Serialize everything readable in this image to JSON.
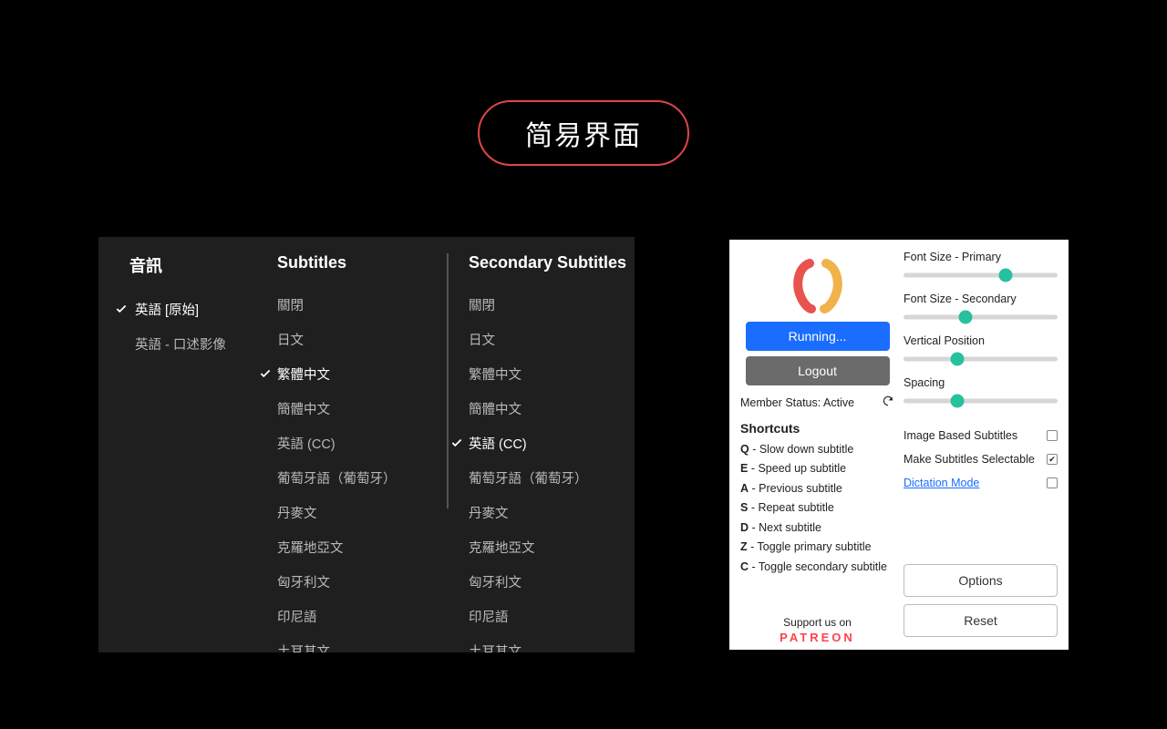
{
  "title": "简易界面",
  "audio": {
    "header": "音訊",
    "items": [
      {
        "label": "英語 [原始]",
        "selected": true
      },
      {
        "label": "英語 - 口述影像",
        "selected": false
      }
    ]
  },
  "subtitles": {
    "header": "Subtitles",
    "items": [
      {
        "label": "關閉",
        "selected": false
      },
      {
        "label": "日文",
        "selected": false
      },
      {
        "label": "繁體中文",
        "selected": true
      },
      {
        "label": "簡體中文",
        "selected": false
      },
      {
        "label": "英語 (CC)",
        "selected": false
      },
      {
        "label": "葡萄牙語（葡萄牙）",
        "selected": false
      },
      {
        "label": "丹麥文",
        "selected": false
      },
      {
        "label": "克羅地亞文",
        "selected": false
      },
      {
        "label": "匈牙利文",
        "selected": false
      },
      {
        "label": "印尼語",
        "selected": false
      },
      {
        "label": "土耳其文",
        "selected": false
      }
    ]
  },
  "secondary": {
    "header": "Secondary Subtitles",
    "items": [
      {
        "label": "關閉",
        "selected": false
      },
      {
        "label": "日文",
        "selected": false
      },
      {
        "label": "繁體中文",
        "selected": false
      },
      {
        "label": "簡體中文",
        "selected": false
      },
      {
        "label": "英語 (CC)",
        "selected": true
      },
      {
        "label": "葡萄牙語（葡萄牙）",
        "selected": false
      },
      {
        "label": "丹麥文",
        "selected": false
      },
      {
        "label": "克羅地亞文",
        "selected": false
      },
      {
        "label": "匈牙利文",
        "selected": false
      },
      {
        "label": "印尼語",
        "selected": false
      },
      {
        "label": "土耳其文",
        "selected": false
      }
    ]
  },
  "ext": {
    "running": "Running...",
    "logout": "Logout",
    "member_status_label": "Member Status:",
    "member_status_value": "Active",
    "shortcuts_header": "Shortcuts",
    "shortcuts": [
      {
        "key": "Q",
        "desc": "Slow down subtitle"
      },
      {
        "key": "E",
        "desc": "Speed up subtitle"
      },
      {
        "key": "A",
        "desc": "Previous subtitle"
      },
      {
        "key": "S",
        "desc": "Repeat subtitle"
      },
      {
        "key": "D",
        "desc": "Next subtitle"
      },
      {
        "key": "Z",
        "desc": "Toggle primary subtitle"
      },
      {
        "key": "C",
        "desc": "Toggle secondary subtitle"
      }
    ],
    "support_label": "Support us on",
    "patreon": "PATREON",
    "sliders": [
      {
        "label": "Font Size - Primary",
        "value": 0.66
      },
      {
        "label": "Font Size - Secondary",
        "value": 0.4
      },
      {
        "label": "Vertical Position",
        "value": 0.35
      },
      {
        "label": "Spacing",
        "value": 0.35
      }
    ],
    "checks": [
      {
        "label": "Image Based Subtitles",
        "checked": false,
        "link": false
      },
      {
        "label": "Make Subtitles Selectable",
        "checked": true,
        "link": false
      },
      {
        "label": "Dictation Mode",
        "checked": false,
        "link": true
      }
    ],
    "options": "Options",
    "reset": "Reset"
  }
}
